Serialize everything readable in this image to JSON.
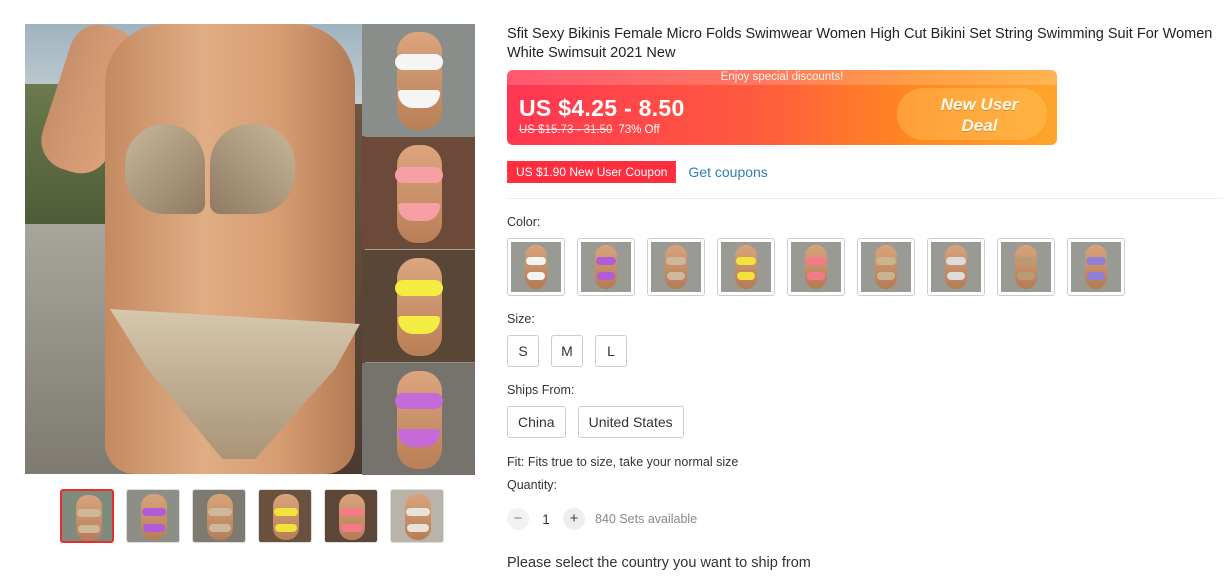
{
  "product": {
    "title": "Sfit Sexy Bikinis Female Micro Folds Swimwear Women High Cut Bikini Set String Swimming Suit For Women White Swimsuit 2021 New"
  },
  "price_banner": {
    "strip_text": "Enjoy special discounts!",
    "price": "US $4.25 - 8.50",
    "original_price": "US $15.73 - 31.50",
    "discount": "73% Off",
    "badge": "New User Deal",
    "colors": {
      "start": "#ff3552",
      "end": "#ffa52b"
    }
  },
  "coupon": {
    "tag": "US $1.90 New User Coupon",
    "link": "Get coupons"
  },
  "color_section": {
    "label": "Color:",
    "swatches": [
      {
        "name": "white",
        "suit": "#f4f4f4"
      },
      {
        "name": "purple",
        "suit": "#b15cd6"
      },
      {
        "name": "beige",
        "suit": "#cdb89a"
      },
      {
        "name": "yellow",
        "suit": "#f2e23c"
      },
      {
        "name": "pink",
        "suit": "#f47a8a"
      },
      {
        "name": "khaki",
        "suit": "#c9b48f"
      },
      {
        "name": "light-gray",
        "suit": "#dcdcdc"
      },
      {
        "name": "tan",
        "suit": "#b89b75"
      },
      {
        "name": "lavender",
        "suit": "#8f7fd8"
      }
    ]
  },
  "size_section": {
    "label": "Size:",
    "options": [
      "S",
      "M",
      "L"
    ]
  },
  "ships_from": {
    "label": "Ships From:",
    "options": [
      "China",
      "United States"
    ]
  },
  "fit": "Fit: Fits true to size, take your normal size",
  "quantity": {
    "label": "Quantity:",
    "minus": "−",
    "value": "1",
    "plus": "+",
    "available": "840 Sets available"
  },
  "ship_note": "Please select the country you want to ship from",
  "gallery": {
    "side_tiles": [
      {
        "name": "white-bikini-photo",
        "suit": "#f5f5f5",
        "bg": "#8a8e8a"
      },
      {
        "name": "pink-bikini-photo",
        "suit": "#f6a0a6",
        "bg": "#6b4a3a"
      },
      {
        "name": "yellow-bikini-photo",
        "suit": "#f3ec43",
        "bg": "#5a4636"
      },
      {
        "name": "purple-bikini-photo",
        "suit": "#c56ad8",
        "bg": "#76736d"
      }
    ],
    "thumbnails": [
      {
        "name": "thumb-khaki",
        "suit": "#cdb89a",
        "bg": "#7f8b7c"
      },
      {
        "name": "thumb-purple",
        "suit": "#b15cd6",
        "bg": "#8c8f86"
      },
      {
        "name": "thumb-beige",
        "suit": "#cdb89a",
        "bg": "#7d7a70"
      },
      {
        "name": "thumb-yellow",
        "suit": "#f2e23c",
        "bg": "#6a513e"
      },
      {
        "name": "thumb-pink",
        "suit": "#f47a8a",
        "bg": "#5c4638"
      },
      {
        "name": "thumb-collage",
        "suit": "#e9e2d6",
        "bg": "#b9b3aa"
      }
    ]
  }
}
